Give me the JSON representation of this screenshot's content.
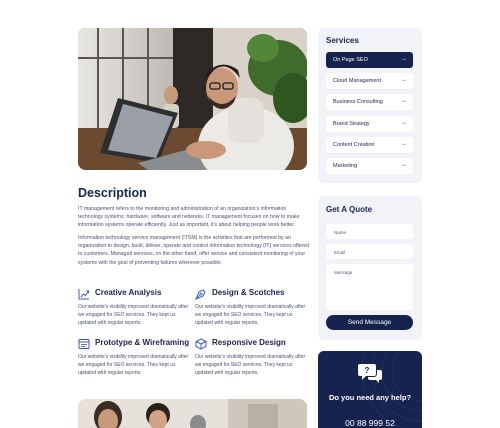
{
  "main": {
    "section_title": "Description",
    "paragraphs": [
      "IT management refers to the monitoring and administration of an organization's information technology systems: hardware, software and networks. IT management focuses on how to make information systems operate efficiently. Just as important, it's about helping people work better.",
      "Information technology service management (ITSM) is the activities that are performed by an organization to design, build, deliver, operate and control information technology (IT) services offered to customers. Managed services, on the other hand, offer service and consistent monitoring of your systems with the goal of preventing failures wherever possible."
    ],
    "features": [
      {
        "title": "Creative Analysis",
        "icon": "chart-icon",
        "desc": "Our website's visibility improved dramatically after we engaged for SEO services. They kept us updated with regular reports."
      },
      {
        "title": "Design & Scotches",
        "icon": "pen-tool-icon",
        "desc": "Our website's visibility improved dramatically after we engaged for SEO services. They kept us updated with regular reports."
      },
      {
        "title": "Prototype & Wireframing",
        "icon": "browser-window-icon",
        "desc": "Our website's visibility improved dramatically after we engaged for SEO services. They kept us updated with regular reports."
      },
      {
        "title": "Responsive Design",
        "icon": "cube-icon",
        "desc": "Our website's visibility improved dramatically after we engaged for SEO services. They kept us updated with regular reports."
      }
    ]
  },
  "sidebar": {
    "services_title": "Services",
    "services": [
      {
        "label": "On Page SEO",
        "active": true
      },
      {
        "label": "Cloud Management",
        "active": false
      },
      {
        "label": "Business Consulting",
        "active": false
      },
      {
        "label": "Brand Strategy",
        "active": false
      },
      {
        "label": "Content Creation",
        "active": false
      },
      {
        "label": "Marketing",
        "active": false
      }
    ],
    "arrow": "→",
    "quote_title": "Get A Quote",
    "quote_fields": {
      "name": "Name",
      "email": "Email",
      "message": "Message"
    },
    "send_label": "Send Message",
    "help_text": "Do you need any help?",
    "help_phone": "00 88 999 52"
  },
  "colors": {
    "navy": "#16234f",
    "card_bg": "#f1f3f8",
    "accent": "#3b58b6"
  }
}
